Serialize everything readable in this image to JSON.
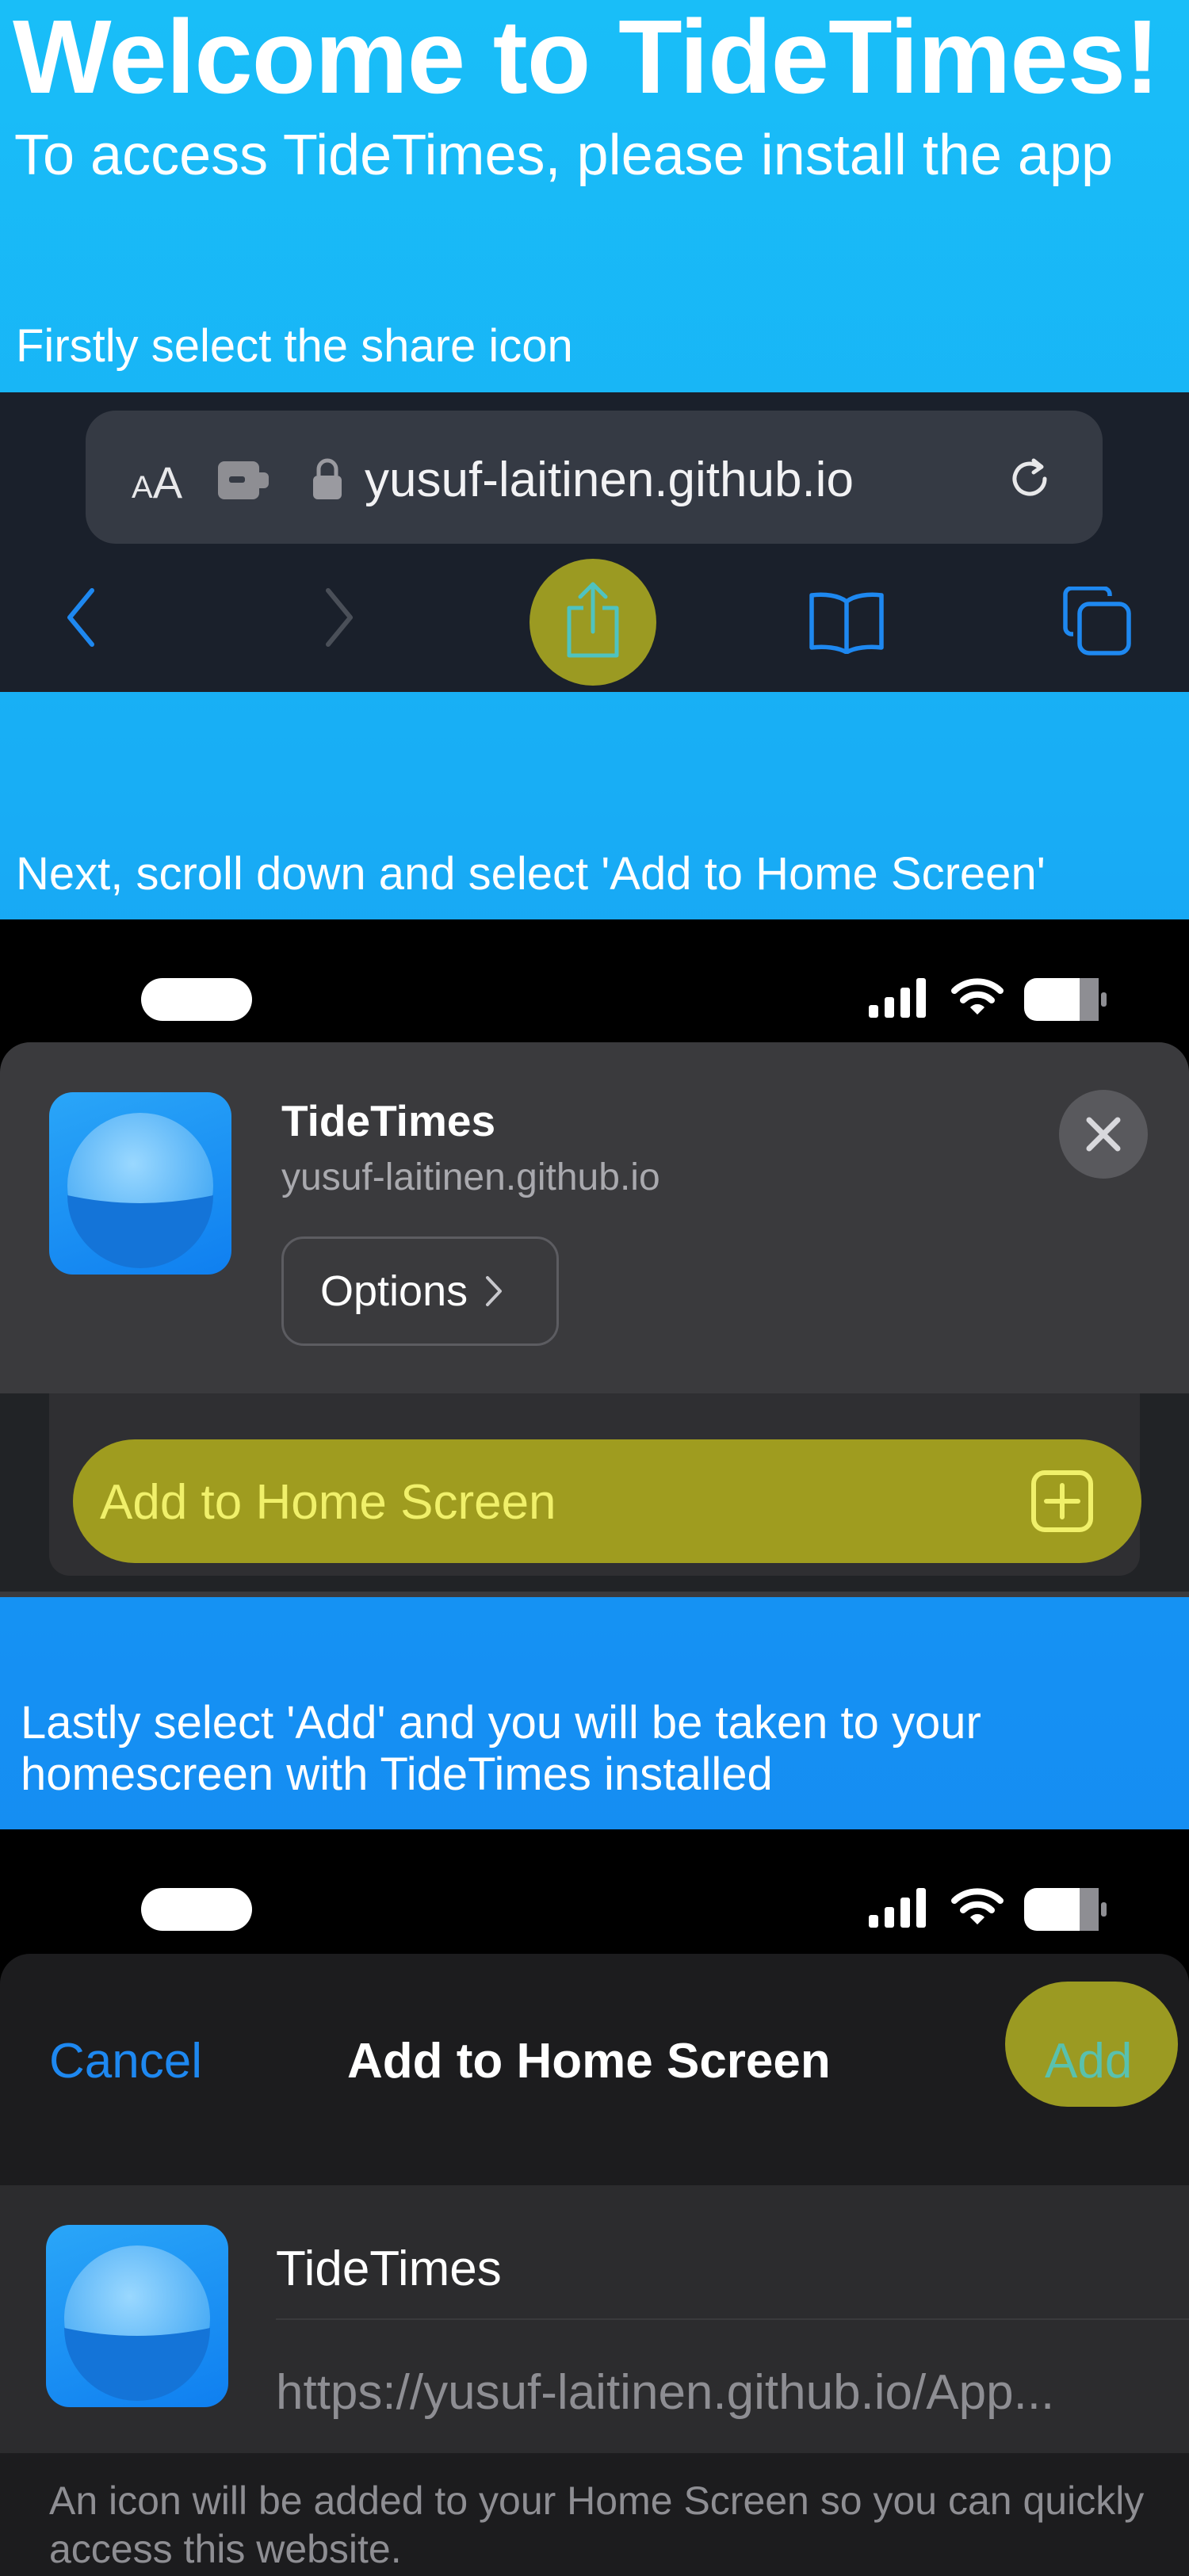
{
  "header": {
    "title": "Welcome to TideTimes!",
    "subtitle": "To access TideTimes, please install the app"
  },
  "steps": {
    "step1": "Firstly select the share icon",
    "step2": "Next, scroll down and select 'Add to Home Screen'",
    "step3_line1": "Lastly select 'Add' and you will be taken to your",
    "step3_line2": "homescreen with TideTimes installed"
  },
  "safari": {
    "text_size_small": "A",
    "text_size_large": "A",
    "url": "yusuf-laitinen.github.io",
    "icons": [
      "text-size-icon",
      "extension-icon",
      "lock-icon",
      "reload-icon",
      "back-icon",
      "forward-icon",
      "share-icon",
      "bookmarks-icon",
      "tabs-icon"
    ]
  },
  "share_sheet": {
    "app_name": "TideTimes",
    "app_url": "yusuf-laitinen.github.io",
    "options_label": "Options",
    "add_to_home_label": "Add to Home Screen"
  },
  "add_sheet": {
    "cancel_label": "Cancel",
    "title": "Add to Home Screen",
    "add_label": "Add",
    "name_value": "TideTimes",
    "url_value": "https://yusuf-laitinen.github.io/App...",
    "footnote": "An icon will be added to your Home Screen so you can quickly access this website."
  },
  "colors": {
    "highlight": "#9b9a22",
    "ios_blue": "#1e88f0",
    "background_top": "#19bef8",
    "background_bottom": "#1584f0"
  }
}
